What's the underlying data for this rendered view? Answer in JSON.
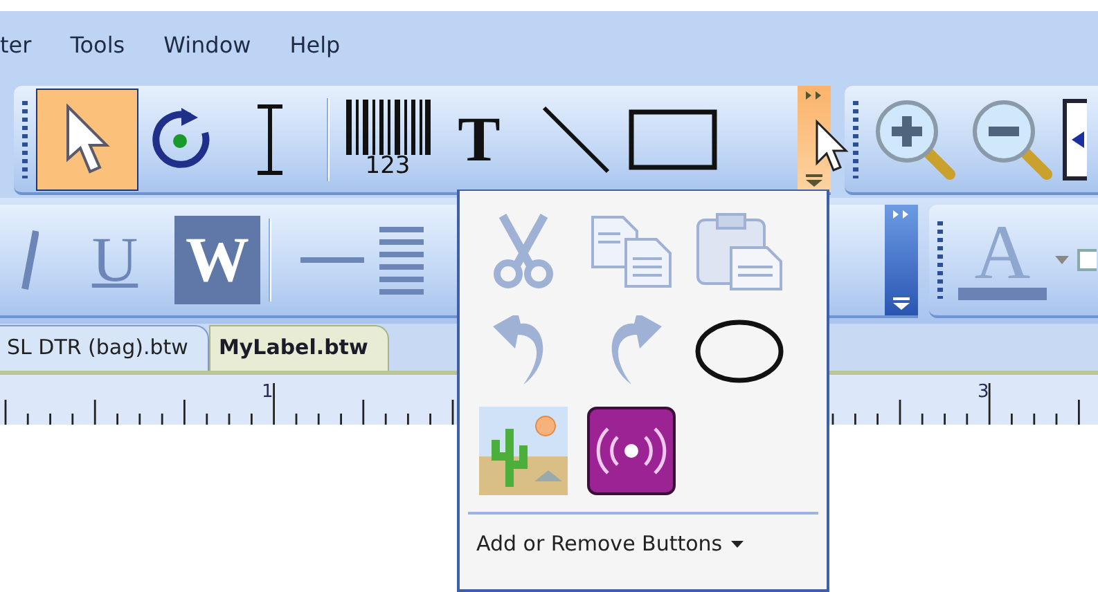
{
  "menu_bar": {
    "items": [
      {
        "label": "ter"
      },
      {
        "label": "Tools"
      },
      {
        "label": "Window"
      },
      {
        "label": "Help"
      }
    ]
  },
  "drawing_toolbar": {
    "tools": [
      {
        "kind": "pointer",
        "selected": true
      },
      {
        "kind": "rotate",
        "selected": false
      },
      {
        "kind": "text-cursor",
        "selected": false
      },
      {
        "kind": "separator"
      },
      {
        "kind": "barcode",
        "caption": "123",
        "selected": false
      },
      {
        "kind": "letter",
        "glyph": "T",
        "selected": false
      },
      {
        "kind": "line",
        "selected": false
      },
      {
        "kind": "rectangle",
        "selected": false
      }
    ],
    "overflow": {
      "open": true
    }
  },
  "zoom_toolbar": {
    "tools": [
      {
        "kind": "zoom-in",
        "selected": false
      },
      {
        "kind": "zoom-out",
        "selected": false
      },
      {
        "kind": "arrow-box",
        "selected": false
      }
    ]
  },
  "format_toolbar": {
    "tools": [
      {
        "kind": "italic",
        "selected": false
      },
      {
        "kind": "letter",
        "glyph": "U",
        "selected": false
      },
      {
        "kind": "letter",
        "glyph": "W",
        "selected": true
      },
      {
        "kind": "separator"
      },
      {
        "kind": "dash",
        "selected": false
      },
      {
        "kind": "justify",
        "selected": false
      }
    ],
    "overflow": {
      "open": false
    }
  },
  "color_toolbar": {
    "tools": [
      {
        "kind": "font-color",
        "glyph": "A",
        "selected": false
      },
      {
        "kind": "edge",
        "selected": false
      }
    ]
  },
  "document_tabs": [
    {
      "label": "SL DTR (bag).btw",
      "selected": false
    },
    {
      "label": "MyLabel.btw",
      "selected": true
    }
  ],
  "ruler": {
    "labels": [
      {
        "label": "1"
      },
      {
        "label": "3"
      }
    ]
  },
  "overflow_menu": {
    "items": [
      {
        "kind": "cut",
        "disabled": true
      },
      {
        "kind": "copy",
        "disabled": true
      },
      {
        "kind": "paste",
        "disabled": true
      },
      {
        "kind": "undo",
        "disabled": true
      },
      {
        "kind": "redo",
        "disabled": true
      },
      {
        "kind": "ellipse",
        "disabled": false
      },
      {
        "kind": "picture",
        "disabled": false
      },
      {
        "kind": "rfid",
        "disabled": false
      }
    ],
    "footer": {
      "label": "Add or Remove Buttons"
    }
  }
}
